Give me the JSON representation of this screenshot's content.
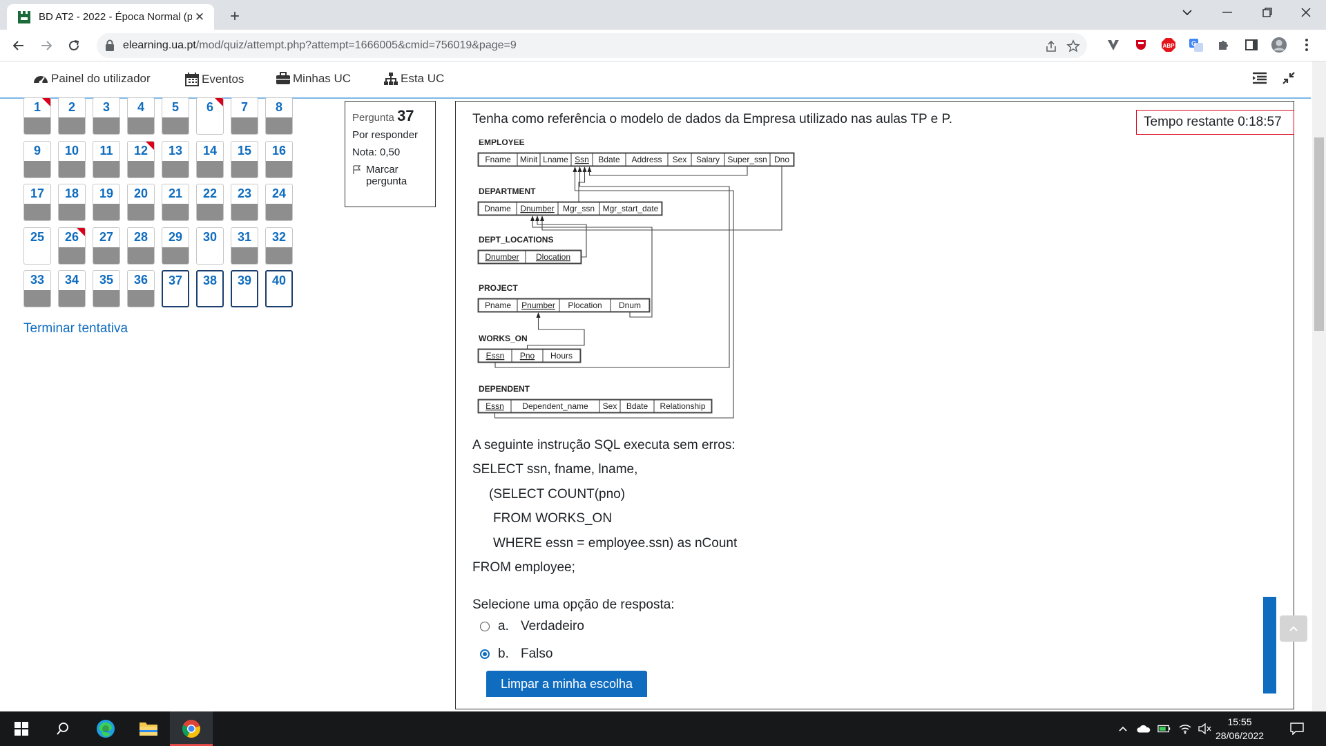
{
  "browser": {
    "tab_title": "BD AT2 - 2022 - Época Normal (p",
    "url_host": "elearning.ua.pt",
    "url_path": "/mod/quiz/attempt.php?attempt=1666005&cmid=756019&page=9"
  },
  "nav": {
    "items": [
      {
        "label": "Painel do utilizador",
        "icon": "dashboard-icon"
      },
      {
        "label": "Eventos",
        "icon": "calendar-icon"
      },
      {
        "label": "Minhas UC",
        "icon": "briefcase-icon"
      },
      {
        "label": "Esta UC",
        "icon": "sitemap-icon"
      }
    ]
  },
  "quiz_nav": {
    "questions": [
      {
        "n": "1",
        "state": "answered",
        "flag": true
      },
      {
        "n": "2",
        "state": "answered",
        "flag": false
      },
      {
        "n": "3",
        "state": "answered",
        "flag": false
      },
      {
        "n": "4",
        "state": "answered",
        "flag": false
      },
      {
        "n": "5",
        "state": "answered",
        "flag": false
      },
      {
        "n": "6",
        "state": "unanswered",
        "flag": true
      },
      {
        "n": "7",
        "state": "answered",
        "flag": false
      },
      {
        "n": "8",
        "state": "answered",
        "flag": false
      },
      {
        "n": "9",
        "state": "answered",
        "flag": false
      },
      {
        "n": "10",
        "state": "answered",
        "flag": false
      },
      {
        "n": "11",
        "state": "answered",
        "flag": false
      },
      {
        "n": "12",
        "state": "answered",
        "flag": true
      },
      {
        "n": "13",
        "state": "answered",
        "flag": false
      },
      {
        "n": "14",
        "state": "answered",
        "flag": false
      },
      {
        "n": "15",
        "state": "answered",
        "flag": false
      },
      {
        "n": "16",
        "state": "answered",
        "flag": false
      },
      {
        "n": "17",
        "state": "answered",
        "flag": false
      },
      {
        "n": "18",
        "state": "answered",
        "flag": false
      },
      {
        "n": "19",
        "state": "answered",
        "flag": false
      },
      {
        "n": "20",
        "state": "answered",
        "flag": false
      },
      {
        "n": "21",
        "state": "answered",
        "flag": false
      },
      {
        "n": "22",
        "state": "answered",
        "flag": false
      },
      {
        "n": "23",
        "state": "answered",
        "flag": false
      },
      {
        "n": "24",
        "state": "answered",
        "flag": false
      },
      {
        "n": "25",
        "state": "unanswered",
        "flag": false
      },
      {
        "n": "26",
        "state": "answered",
        "flag": true
      },
      {
        "n": "27",
        "state": "answered",
        "flag": false
      },
      {
        "n": "28",
        "state": "answered",
        "flag": false
      },
      {
        "n": "29",
        "state": "answered",
        "flag": false
      },
      {
        "n": "30",
        "state": "unanswered",
        "flag": false
      },
      {
        "n": "31",
        "state": "answered",
        "flag": false
      },
      {
        "n": "32",
        "state": "answered",
        "flag": false
      },
      {
        "n": "33",
        "state": "answered",
        "flag": false
      },
      {
        "n": "34",
        "state": "answered",
        "flag": false
      },
      {
        "n": "35",
        "state": "answered",
        "flag": false
      },
      {
        "n": "36",
        "state": "answered",
        "flag": false
      },
      {
        "n": "37",
        "state": "current",
        "flag": false
      },
      {
        "n": "38",
        "state": "current",
        "flag": false
      },
      {
        "n": "39",
        "state": "current",
        "flag": false
      },
      {
        "n": "40",
        "state": "current",
        "flag": false
      }
    ],
    "finish_label": "Terminar tentativa"
  },
  "question_info": {
    "label": "Pergunta",
    "number": "37",
    "status": "Por responder",
    "grade": "Nota: 0,50",
    "flag_label": "Marcar pergunta"
  },
  "timer": "Tempo restante 0:18:57",
  "question": {
    "intro": "Tenha como referência o modelo de dados da Empresa utilizado nas aulas TP e P.",
    "lead": "A seguinte instrução SQL executa sem erros:",
    "sql": [
      "SELECT ssn, fname, lname,",
      "(SELECT COUNT(pno)",
      "FROM WORKS_ON",
      "WHERE essn = employee.ssn) as nCount",
      "FROM  employee;"
    ],
    "prompt": "Selecione uma opção de resposta:",
    "options": [
      {
        "letter": "a.",
        "text": "Verdadeiro",
        "checked": false
      },
      {
        "letter": "b.",
        "text": "Falso",
        "checked": true
      }
    ],
    "clear_label": "Limpar a minha escolha"
  },
  "er_diagram": {
    "tables": [
      {
        "name": "EMPLOYEE",
        "attrs": [
          "Fname",
          "Minit",
          "Lname",
          "Ssn",
          "Bdate",
          "Address",
          "Sex",
          "Salary",
          "Super_ssn",
          "Dno"
        ]
      },
      {
        "name": "DEPARTMENT",
        "attrs": [
          "Dname",
          "Dnumber",
          "Mgr_ssn",
          "Mgr_start_date"
        ]
      },
      {
        "name": "DEPT_LOCATIONS",
        "attrs": [
          "Dnumber",
          "Dlocation"
        ]
      },
      {
        "name": "PROJECT",
        "attrs": [
          "Pname",
          "Pnumber",
          "Plocation",
          "Dnum"
        ]
      },
      {
        "name": "WORKS_ON",
        "attrs": [
          "Essn",
          "Pno",
          "Hours"
        ]
      },
      {
        "name": "DEPENDENT",
        "attrs": [
          "Essn",
          "Dependent_name",
          "Sex",
          "Bdate",
          "Relationship"
        ]
      }
    ]
  },
  "taskbar": {
    "time": "15:55",
    "date": "28/06/2022"
  }
}
